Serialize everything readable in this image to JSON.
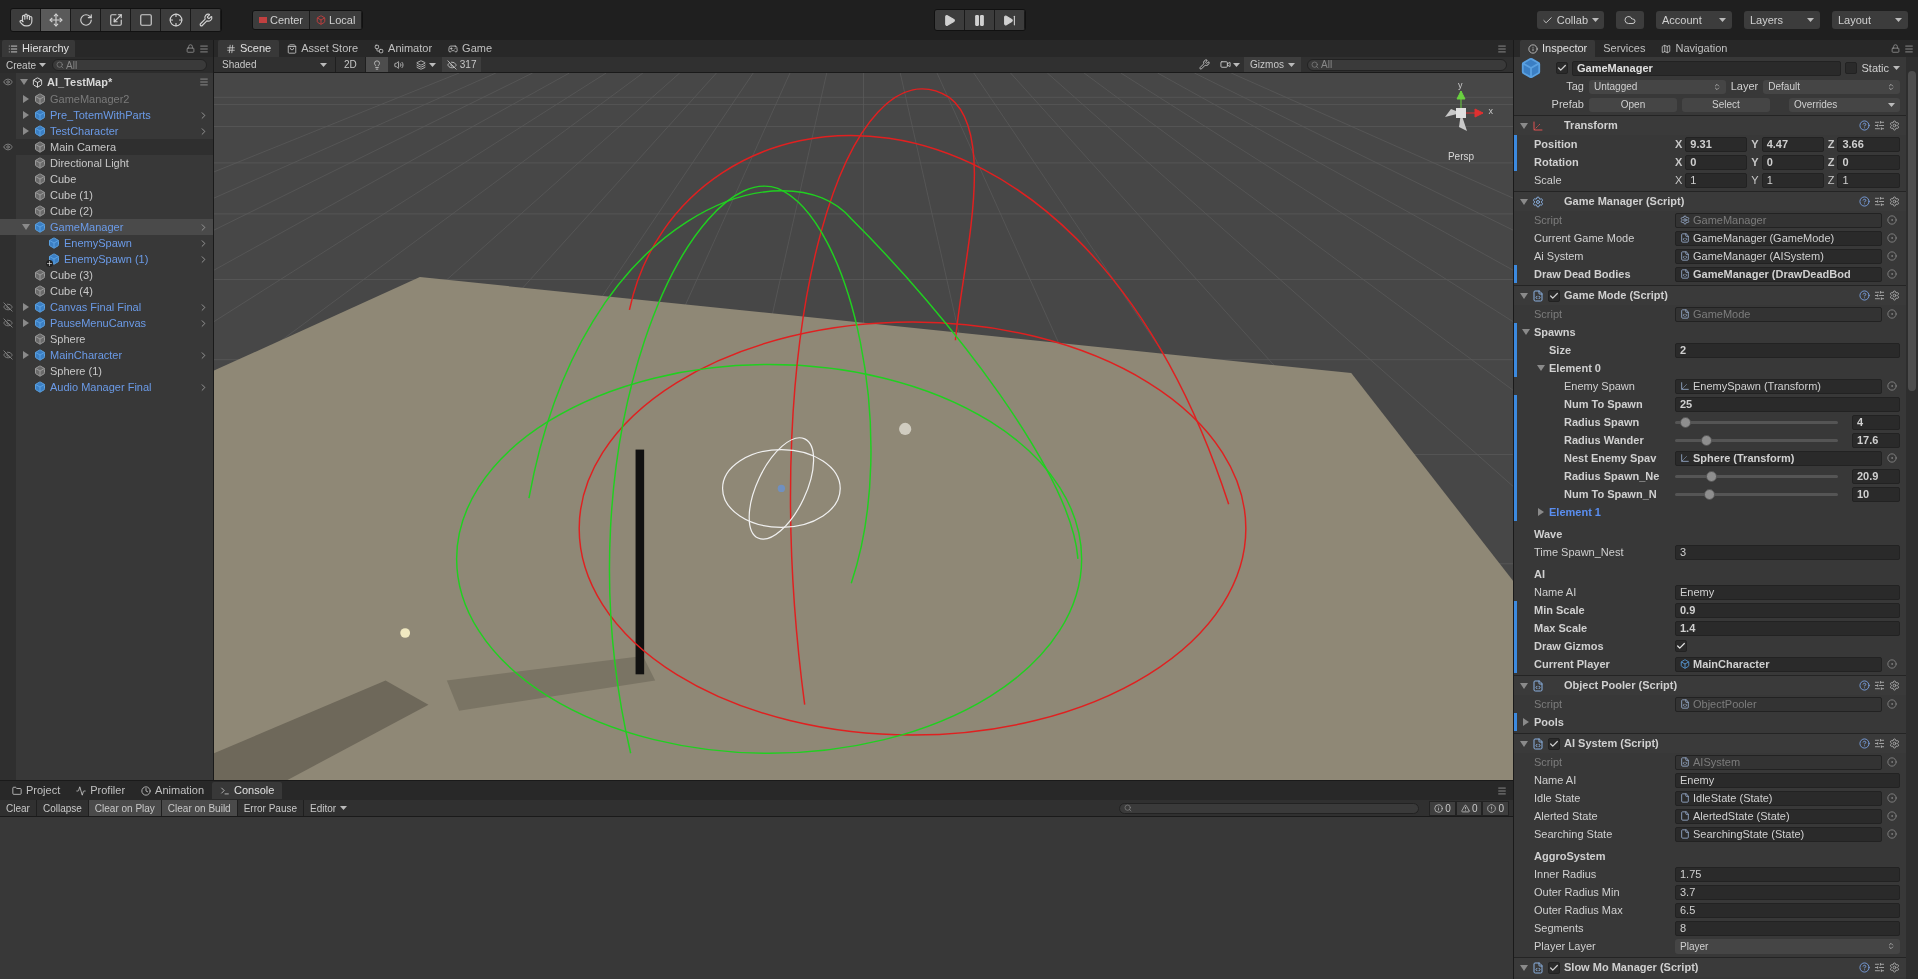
{
  "toolbar": {
    "tools": [
      {
        "kind": "hand",
        "selected": false
      },
      {
        "kind": "move",
        "selected": true
      },
      {
        "kind": "rotate",
        "selected": false
      },
      {
        "kind": "scale",
        "selected": false
      },
      {
        "kind": "rect",
        "selected": false
      },
      {
        "kind": "transform",
        "selected": false
      },
      {
        "kind": "custom",
        "selected": false
      }
    ],
    "pivot": [
      "Center",
      "Local"
    ],
    "playback": [
      {
        "kind": "play",
        "on": false
      },
      {
        "kind": "pause",
        "on": false
      },
      {
        "kind": "step",
        "on": false
      }
    ],
    "right": [
      {
        "kind": "collab",
        "label": "Collab"
      },
      {
        "kind": "cloud"
      },
      {
        "kind": "menu",
        "label": "Account"
      },
      {
        "kind": "menu",
        "label": "Layers"
      },
      {
        "kind": "menu",
        "label": "Layout"
      }
    ]
  },
  "hierarchy": {
    "tab": "Hierarchy",
    "create": "Create",
    "search_placeholder": "All",
    "scene": "AI_TestMap*",
    "items": [
      {
        "name": "GameManager2",
        "prefab": false,
        "disabled": true,
        "selected": false,
        "hovered": false,
        "hidden": false,
        "expanded": false
      },
      {
        "name": "Pre_TotemWithParts",
        "prefab": true,
        "disabled": false,
        "selected": false,
        "hovered": false,
        "hidden": false,
        "expanded": false
      },
      {
        "name": "TestCharacter",
        "prefab": true,
        "disabled": false,
        "selected": false,
        "hovered": false,
        "hidden": false,
        "expanded": false
      },
      {
        "name": "Main Camera",
        "prefab": false,
        "disabled": false,
        "selected": false,
        "hovered": true,
        "hidden": false
      },
      {
        "name": "Directional Light",
        "prefab": false,
        "disabled": false,
        "selected": false,
        "hovered": false,
        "hidden": false
      },
      {
        "name": "Cube",
        "prefab": false,
        "disabled": false,
        "selected": false,
        "hovered": false,
        "hidden": false
      },
      {
        "name": "Cube (1)",
        "prefab": false,
        "disabled": false,
        "selected": false,
        "hovered": false,
        "hidden": false
      },
      {
        "name": "Cube (2)",
        "prefab": false,
        "disabled": false,
        "selected": false,
        "hovered": false,
        "hidden": false
      },
      {
        "name": "GameManager",
        "prefab": true,
        "disabled": false,
        "selected": true,
        "hovered": false,
        "hidden": false,
        "expanded": true,
        "children": [
          {
            "name": "EnemySpawn",
            "prefab": true,
            "disabled": false,
            "selected": false,
            "hovered": false,
            "hidden": false,
            "added": false
          },
          {
            "name": "EnemySpawn (1)",
            "prefab": true,
            "disabled": false,
            "selected": false,
            "hovered": false,
            "hidden": false,
            "added": true
          }
        ]
      },
      {
        "name": "Cube (3)",
        "prefab": false,
        "disabled": false,
        "selected": false,
        "hovered": false,
        "hidden": false
      },
      {
        "name": "Cube (4)",
        "prefab": false,
        "disabled": false,
        "selected": false,
        "hovered": false,
        "hidden": false
      },
      {
        "name": "Canvas Final Final",
        "prefab": true,
        "disabled": false,
        "selected": false,
        "hovered": false,
        "hidden": true,
        "expanded": false
      },
      {
        "name": "PauseMenuCanvas",
        "prefab": true,
        "disabled": false,
        "selected": false,
        "hovered": false,
        "hidden": true,
        "expanded": false
      },
      {
        "name": "Sphere",
        "prefab": false,
        "disabled": false,
        "selected": false,
        "hovered": false,
        "hidden": false
      },
      {
        "name": "MainCharacter",
        "prefab": true,
        "disabled": false,
        "selected": false,
        "hovered": false,
        "hidden": true,
        "expanded": false
      },
      {
        "name": "Sphere (1)",
        "prefab": false,
        "disabled": false,
        "selected": false,
        "hovered": false,
        "hidden": false
      },
      {
        "name": "Audio Manager Final",
        "prefab": true,
        "disabled": false,
        "selected": false,
        "hovered": false,
        "hidden": false
      }
    ]
  },
  "scene": {
    "tabs": [
      {
        "kind": "scene",
        "label": "Scene",
        "selected": true
      },
      {
        "kind": "store",
        "label": "Asset Store",
        "selected": false
      },
      {
        "kind": "animator",
        "label": "Animator",
        "selected": false
      },
      {
        "kind": "game",
        "label": "Game",
        "selected": false
      }
    ],
    "shading": "Shaded",
    "mode_2d": {
      "label": "2D",
      "on": false
    },
    "lighting_on": true,
    "audio_on": false,
    "effects_on": false,
    "hidden_count": "317",
    "gizmos": "Gizmos",
    "search_placeholder": "All",
    "gizmo": {
      "y_label": "y",
      "x_label": "x",
      "projection": "Persp"
    }
  },
  "inspector": {
    "tabs": [
      {
        "kind": "inspector",
        "label": "Inspector",
        "selected": true
      },
      {
        "kind": "services",
        "label": "Services",
        "selected": false
      },
      {
        "kind": "navigation",
        "label": "Navigation",
        "selected": false
      }
    ],
    "object": {
      "active": true,
      "name": "GameManager",
      "static": false,
      "static_label": "Static",
      "tag_label": "Tag",
      "tag": "Untagged",
      "layer_label": "Layer",
      "layer": "Default",
      "prefab_label": "Prefab",
      "prefab_buttons": [
        "Open",
        "Select",
        "Overrides"
      ]
    },
    "components": [
      {
        "kind": "transform",
        "title": "Transform",
        "expanded": true,
        "rows": [
          {
            "kind": "vector3",
            "label": "Position",
            "overridden": true,
            "axes": [
              "X",
              "Y",
              "Z"
            ],
            "values": [
              "9.31",
              "4.47",
              "3.66"
            ]
          },
          {
            "kind": "vector3",
            "label": "Rotation",
            "overridden": true,
            "axes": [
              "X",
              "Y",
              "Z"
            ],
            "values": [
              "0",
              "0",
              "0"
            ]
          },
          {
            "kind": "vector3",
            "label": "Scale",
            "overridden": false,
            "axes": [
              "X",
              "Y",
              "Z"
            ],
            "values": [
              "1",
              "1",
              "1"
            ]
          }
        ]
      },
      {
        "kind": "settings",
        "title": "Game Manager (Script)",
        "expanded": true,
        "rows": [
          {
            "kind": "settings_ref",
            "label": "Script",
            "value": "GameManager",
            "readonly": true,
            "overridden": false
          },
          {
            "kind": "script_ref",
            "label": "Current Game Mode",
            "value": "GameManager (GameMode)",
            "readonly": false,
            "overridden": false
          },
          {
            "kind": "script_ref",
            "label": "Ai System",
            "value": "GameManager (AISystem)",
            "readonly": false,
            "overridden": false
          },
          {
            "kind": "script_ref",
            "label": "Draw Dead Bodies",
            "value": "GameManager (DrawDeadBod",
            "readonly": false,
            "overridden": true
          }
        ]
      },
      {
        "kind": "script",
        "title": "Game Mode (Script)",
        "enabled": true,
        "expanded": true,
        "rows": [
          {
            "kind": "script_ref",
            "label": "Script",
            "value": "GameMode",
            "readonly": true,
            "overridden": false
          },
          {
            "kind": "foldout",
            "label": "Spawns",
            "expanded": true,
            "overridden": true,
            "added": false,
            "children": [
              {
                "kind": "text",
                "label": "Size",
                "value": "2",
                "overridden": true
              },
              {
                "kind": "foldout",
                "label": "Element 0",
                "expanded": true,
                "overridden": true,
                "added": false,
                "children": [
                  {
                    "kind": "transform_ref",
                    "label": "Enemy Spawn",
                    "value": "EnemySpawn (Transform)",
                    "readonly": false,
                    "overridden": false
                  },
                  {
                    "kind": "text",
                    "label": "Num To Spawn",
                    "value": "25",
                    "overridden": true
                  },
                  {
                    "kind": "slider",
                    "label": "Radius Spawn",
                    "level": 0.06,
                    "value": "4",
                    "overridden": true
                  },
                  {
                    "kind": "slider",
                    "label": "Radius Wander",
                    "level": 0.19,
                    "value": "17.6",
                    "overridden": true
                  },
                  {
                    "kind": "transform_ref",
                    "label": "Nest Enemy Spav",
                    "value": "Sphere (Transform)",
                    "readonly": false,
                    "overridden": true
                  },
                  {
                    "kind": "slider",
                    "label": "Radius Spawn_Ne",
                    "level": 0.22,
                    "value": "20.9",
                    "overridden": true
                  },
                  {
                    "kind": "slider",
                    "label": "Num To Spawn_N",
                    "level": 0.21,
                    "value": "10",
                    "overridden": true
                  }
                ]
              },
              {
                "kind": "foldout",
                "label": "Element 1",
                "expanded": false,
                "overridden": true,
                "added": true
              }
            ]
          },
          {
            "kind": "header",
            "label": "Wave"
          },
          {
            "kind": "text",
            "label": "Time Spawn_Nest",
            "value": "3",
            "overridden": false
          },
          {
            "kind": "header",
            "label": "AI"
          },
          {
            "kind": "text",
            "label": "Name AI",
            "value": "Enemy",
            "overridden": false
          },
          {
            "kind": "text",
            "label": "Min Scale",
            "value": "0.9",
            "overridden": true
          },
          {
            "kind": "text",
            "label": "Max Scale",
            "value": "1.4",
            "overridden": true
          },
          {
            "kind": "checkbox",
            "label": "Draw Gizmos",
            "checked": true,
            "overridden": true
          },
          {
            "kind": "prefab_ref",
            "label": "Current Player",
            "value": "MainCharacter",
            "readonly": false,
            "overridden": true
          }
        ]
      },
      {
        "kind": "script",
        "title": "Object Pooler (Script)",
        "expanded": true,
        "rows": [
          {
            "kind": "script_ref",
            "label": "Script",
            "value": "ObjectPooler",
            "readonly": true,
            "overridden": false
          },
          {
            "kind": "foldout",
            "label": "Pools",
            "expanded": false,
            "overridden": true,
            "added": false
          }
        ]
      },
      {
        "kind": "script",
        "title": "AI System (Script)",
        "enabled": true,
        "expanded": true,
        "rows": [
          {
            "kind": "script_ref",
            "label": "Script",
            "value": "AISystem",
            "readonly": true,
            "overridden": false
          },
          {
            "kind": "text",
            "label": "Name AI",
            "value": "Enemy",
            "overridden": false
          },
          {
            "kind": "state_ref",
            "label": "Idle State",
            "value": "IdleState (State)",
            "readonly": false,
            "overridden": false
          },
          {
            "kind": "state_ref",
            "label": "Alerted State",
            "value": "AlertedState (State)",
            "readonly": false,
            "overridden": false
          },
          {
            "kind": "state_ref",
            "label": "Searching State",
            "value": "SearchingState (State)",
            "readonly": false,
            "overridden": false
          },
          {
            "kind": "header",
            "label": "AggroSystem"
          },
          {
            "kind": "text",
            "label": "Inner Radius",
            "value": "1.75",
            "overridden": false
          },
          {
            "kind": "text",
            "label": "Outer Radius Min",
            "value": "3.7",
            "overridden": false
          },
          {
            "kind": "text",
            "label": "Outer Radius Max",
            "value": "6.5",
            "overridden": false
          },
          {
            "kind": "text",
            "label": "Segments",
            "value": "8",
            "overridden": false
          },
          {
            "kind": "dropdown",
            "label": "Player Layer",
            "value": "Player",
            "overridden": false
          }
        ]
      },
      {
        "kind": "script",
        "title": "Slow Mo Manager (Script)",
        "enabled": true,
        "expanded": true
      }
    ]
  },
  "console": {
    "tabs": [
      {
        "kind": "project",
        "label": "Project",
        "selected": false
      },
      {
        "kind": "profiler",
        "label": "Profiler",
        "selected": false
      },
      {
        "kind": "animation",
        "label": "Animation",
        "selected": false
      },
      {
        "kind": "console",
        "label": "Console",
        "selected": true
      }
    ],
    "buttons": [
      {
        "label": "Clear",
        "on": false
      },
      {
        "label": "Collapse",
        "on": false
      },
      {
        "label": "Clear on Play",
        "on": true
      },
      {
        "label": "Clear on Build",
        "on": true
      },
      {
        "label": "Error Pause",
        "on": false
      }
    ],
    "editor": "Editor",
    "counts": [
      {
        "kind": "info",
        "value": "0"
      },
      {
        "kind": "warning",
        "value": "0"
      },
      {
        "kind": "error",
        "value": "0"
      }
    ]
  }
}
